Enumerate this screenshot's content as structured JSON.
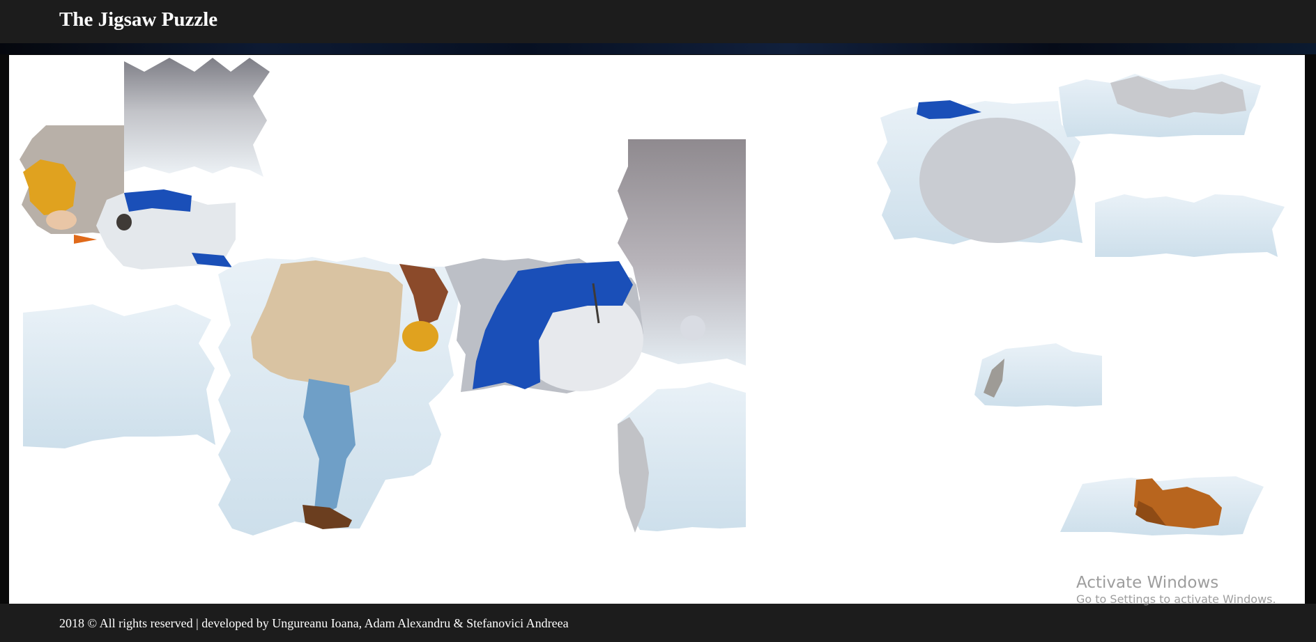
{
  "header": {
    "title": "The Jigsaw Puzzle"
  },
  "board": {
    "image_subject": "Girl in a knit sweater with a snowman in the snow",
    "placed_pieces": 11,
    "loose_pieces": 5
  },
  "footer": {
    "text": "2018 © All rights reserved | developed by Ungureanu Ioana, Adam Alexandru & Stefanovici Andreea"
  },
  "watermark": {
    "title": "Activate Windows",
    "subtitle": "Go to Settings to activate Windows."
  },
  "colors": {
    "header_bg": "#1c1c1c",
    "board_bg": "#ffffff",
    "snow": "#dbe8f2",
    "scarf": "#1a4fb8",
    "hat": "#e0a21f",
    "sweater": "#d9c3a2",
    "jeans": "#6f9fc7",
    "boots": "#b8651e"
  }
}
